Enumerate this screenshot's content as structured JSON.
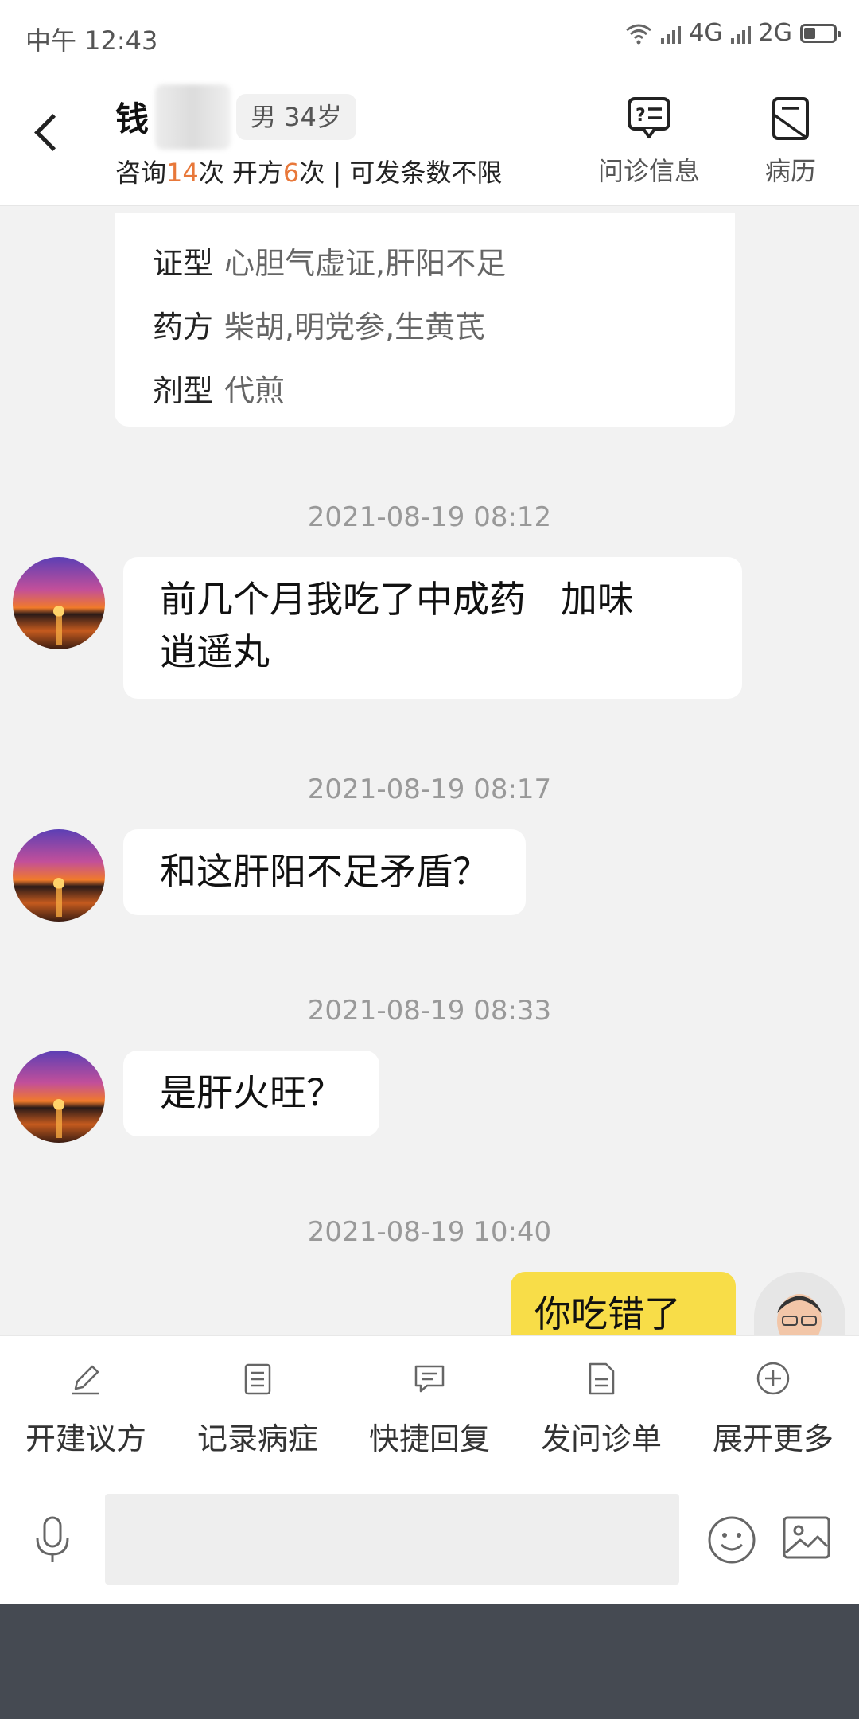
{
  "status_bar": {
    "time": "中午 12:43",
    "net1": "4G",
    "net2": "2G",
    "battery_level": 0.4
  },
  "header": {
    "name": "钱",
    "gender_age": "男 34岁",
    "stats_prefix": "咨询",
    "consult_count": "14",
    "stats_mid": "次 开方",
    "rx_count": "6",
    "stats_suffix": "次 | 可发条数不限",
    "btn_info": "问诊信息",
    "btn_record": "病历",
    "highlight_color": "#e8783a"
  },
  "prescription": {
    "syndrome_label": "证型",
    "syndrome": "心胆气虚证,肝阳不足",
    "formula_label": "药方",
    "formula": "柴胡,明党参,生黄芪",
    "dosage_label": "剂型",
    "dosage": "代煎"
  },
  "messages": [
    {
      "time": "2021-08-19 08:12",
      "line1": "前几个月我吃了中成药   加味",
      "line2": "逍遥丸"
    },
    {
      "time": "2021-08-19 08:17",
      "text": "和这肝阳不足矛盾？"
    },
    {
      "time": "2021-08-19 08:33",
      "text": "是肝火旺？"
    },
    {
      "time": "2021-08-19 10:40",
      "text": "你吃错了"
    }
  ],
  "toolbar": [
    {
      "label": "开建议方",
      "icon": "pen-icon"
    },
    {
      "label": "记录病症",
      "icon": "record-icon"
    },
    {
      "label": "快捷回复",
      "icon": "quick-reply-icon"
    },
    {
      "label": "发问诊单",
      "icon": "form-icon"
    },
    {
      "label": "展开更多",
      "icon": "plus-circle-icon"
    }
  ],
  "input": {
    "placeholder": ""
  },
  "colors": {
    "my_bubble": "#f8dd48",
    "background": "#f2f2f2",
    "nav_bar": "#454a52"
  }
}
